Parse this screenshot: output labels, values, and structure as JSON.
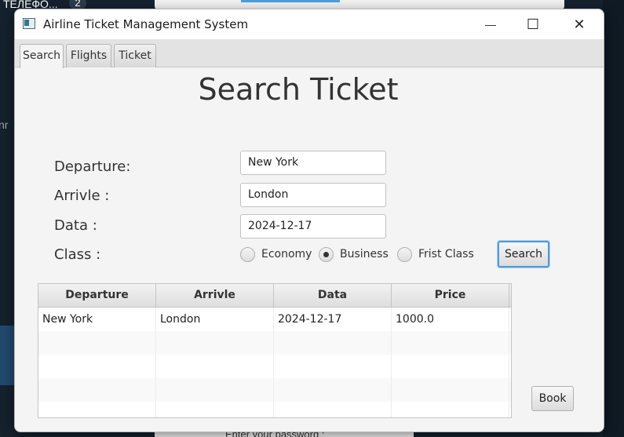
{
  "background": {
    "taskbar_text": "ТЕЛЕФО...",
    "badge": "2",
    "side_text": "nr",
    "bottom_panel_text": "Enter your password :"
  },
  "window": {
    "title": "Airline Ticket Management System",
    "controls": {
      "minimize": "—",
      "maximize": "☐",
      "close": "✕"
    }
  },
  "tabs": [
    {
      "label": "Search",
      "active": true
    },
    {
      "label": "Flights",
      "active": false
    },
    {
      "label": "Ticket",
      "active": false
    }
  ],
  "page": {
    "heading": "Search Ticket",
    "labels": {
      "departure": "Departure:",
      "arrival": "Arrivle :",
      "date": "Data :",
      "class": "Class :"
    },
    "fields": {
      "departure": "New York",
      "arrival": "London",
      "date": "2024-12-17"
    },
    "class_options": [
      {
        "label": "Economy",
        "checked": false
      },
      {
        "label": "Business",
        "checked": true
      },
      {
        "label": "Frist Class",
        "checked": false
      }
    ],
    "search_button": "Search",
    "book_button": "Book"
  },
  "table": {
    "headers": [
      "Departure",
      "Arrivle",
      "Data",
      "Price"
    ],
    "rows": [
      [
        "New York",
        "London",
        "2024-12-17",
        "1000.0"
      ]
    ]
  }
}
